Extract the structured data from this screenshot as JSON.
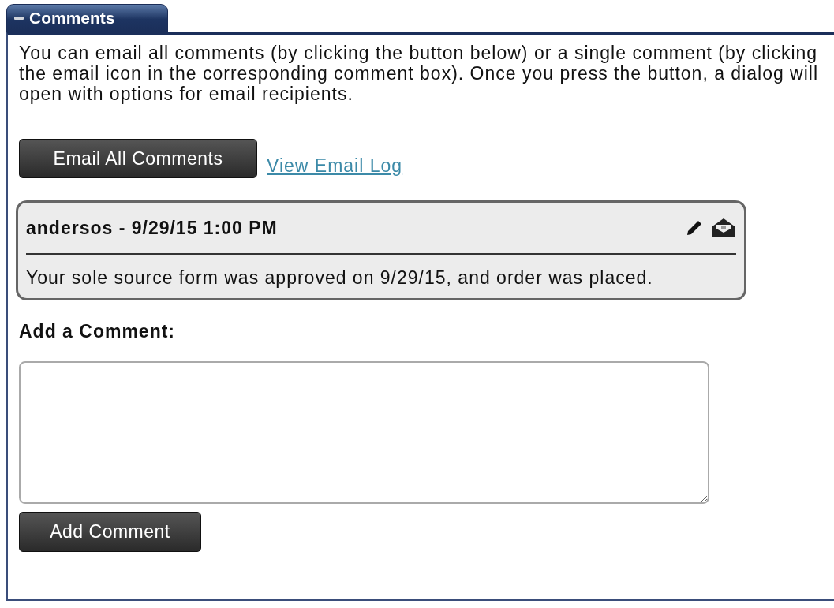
{
  "panel": {
    "title": "Comments",
    "expanded": true
  },
  "intro": "You can email all comments (by clicking the button below) or a single comment (by clicking the email icon in the corresponding comment box). Once you press the button, a dialog will open with options for email recipients.",
  "email_all_button": "Email All Comments",
  "email_log_link": "View Email Log",
  "comments": [
    {
      "header": "andersos - 9/29/15 1:00 PM",
      "body": "Your sole source form was approved on 9/29/15, and order was placed."
    }
  ],
  "add_comment": {
    "label": "Add a Comment:",
    "button": "Add Comment"
  }
}
